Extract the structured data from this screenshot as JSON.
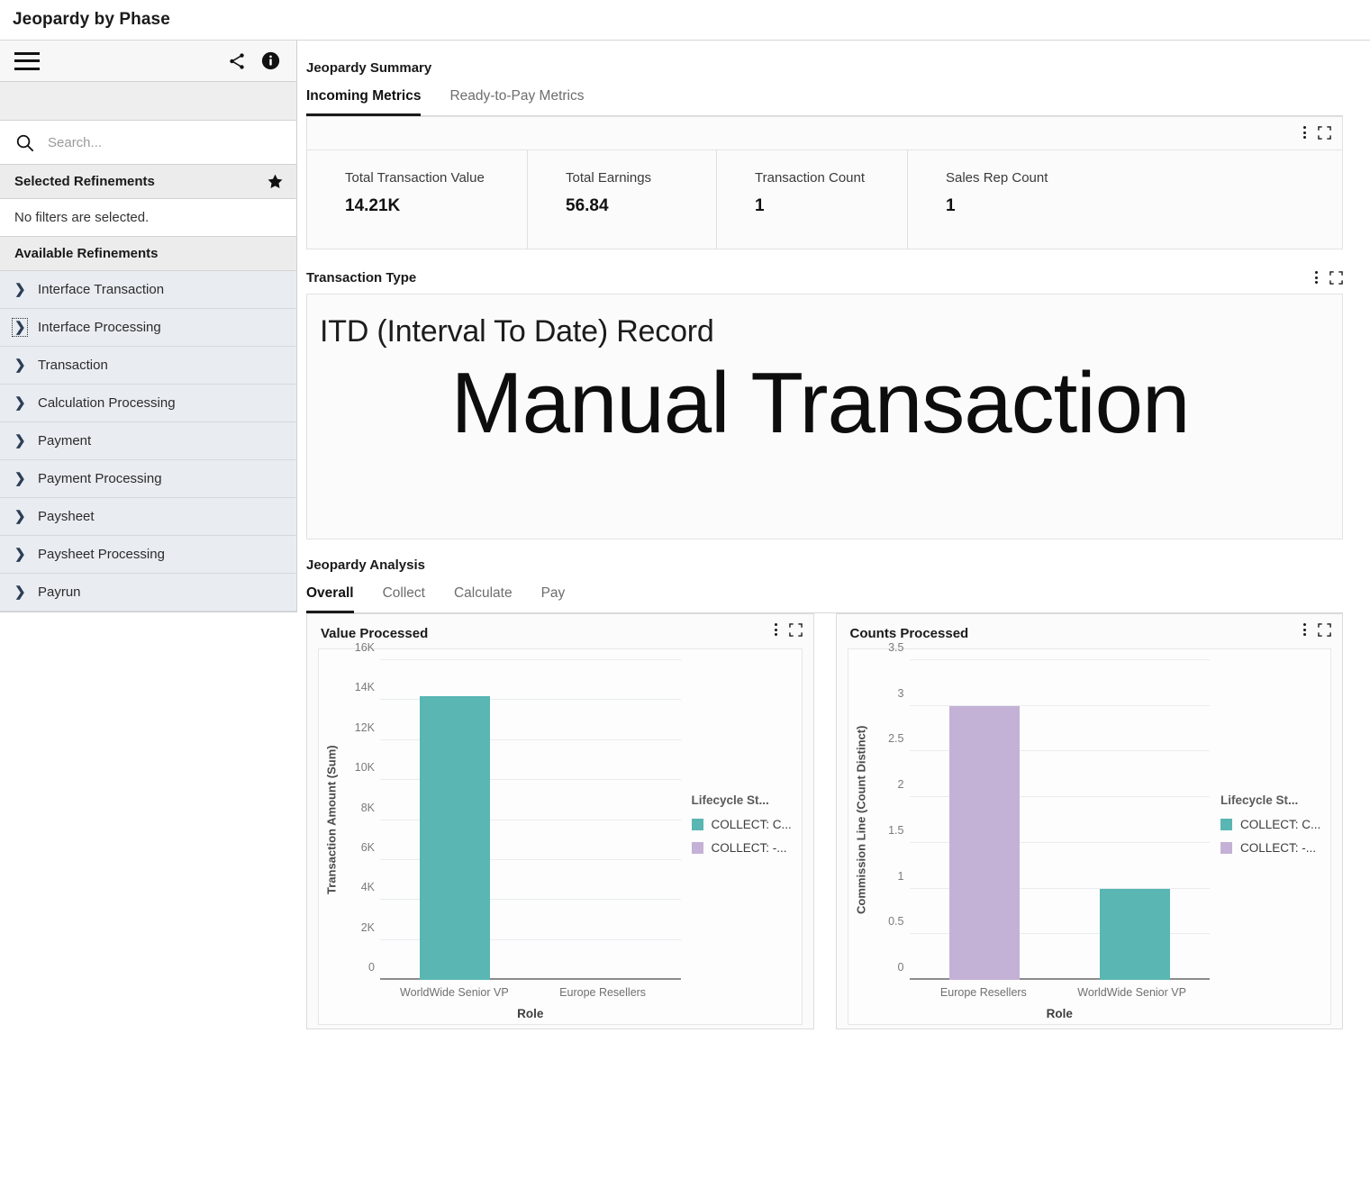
{
  "page": {
    "title": "Jeopardy by Phase"
  },
  "sidebar": {
    "toolbar": {
      "menu_icon": "hamburger-icon",
      "share_icon": "share-icon",
      "info_icon": "info-icon"
    },
    "search": {
      "placeholder": "Search...",
      "value": "",
      "icon": "search-icon"
    },
    "selected_refinements": {
      "label": "Selected Refinements",
      "star_icon": "star-icon",
      "empty_text": "No filters are selected."
    },
    "available_refinements": {
      "label": "Available Refinements",
      "items": [
        {
          "label": "Interface Transaction",
          "focused": false
        },
        {
          "label": "Interface Processing",
          "focused": true
        },
        {
          "label": "Transaction",
          "focused": false
        },
        {
          "label": "Calculation Processing",
          "focused": false
        },
        {
          "label": "Payment",
          "focused": false
        },
        {
          "label": "Payment Processing",
          "focused": false
        },
        {
          "label": "Paysheet",
          "focused": false
        },
        {
          "label": "Paysheet Processing",
          "focused": false
        },
        {
          "label": "Payrun",
          "focused": false
        }
      ]
    }
  },
  "summary": {
    "title": "Jeopardy Summary",
    "tabs": [
      {
        "label": "Incoming Metrics",
        "active": true
      },
      {
        "label": "Ready-to-Pay Metrics",
        "active": false
      }
    ],
    "metrics": [
      {
        "label": "Total Transaction Value",
        "value": "14.21K"
      },
      {
        "label": "Total Earnings",
        "value": "56.84"
      },
      {
        "label": "Transaction Count",
        "value": "1"
      },
      {
        "label": "Sales Rep Count",
        "value": "1"
      }
    ],
    "controls": {
      "menu_icon": "kebab-menu-icon",
      "expand_icon": "expand-icon"
    }
  },
  "transaction_type": {
    "title": "Transaction Type",
    "subtitle": "ITD (Interval To Date) Record",
    "value": "Manual Transaction",
    "controls": {
      "menu_icon": "kebab-menu-icon",
      "expand_icon": "expand-icon"
    }
  },
  "analysis": {
    "title": "Jeopardy Analysis",
    "tabs": [
      {
        "label": "Overall",
        "active": true
      },
      {
        "label": "Collect",
        "active": false
      },
      {
        "label": "Calculate",
        "active": false
      },
      {
        "label": "Pay",
        "active": false
      }
    ]
  },
  "colors": {
    "teal": "#59b6b3",
    "purple": "#c4b1d6",
    "accent_underline": "#1a1a1a",
    "sidebar_item_bg": "#e9edf2"
  },
  "chart_data": [
    {
      "type": "bar",
      "title": "Value Processed",
      "xlabel": "Role",
      "ylabel": "Transaction Amount (Sum)",
      "categories": [
        "WorldWide Senior VP",
        "Europe Resellers"
      ],
      "values": [
        14210,
        0
      ],
      "bar_colors": [
        "#59b6b3",
        "#c4b1d6"
      ],
      "ylim": [
        0,
        16000
      ],
      "yticks": [
        0,
        2000,
        4000,
        6000,
        8000,
        10000,
        12000,
        14000,
        16000
      ],
      "ytick_labels": [
        "0",
        "2K",
        "4K",
        "6K",
        "8K",
        "10K",
        "12K",
        "14K",
        "16K"
      ],
      "grid": true,
      "legend_position": "right",
      "legend_title": "Lifecycle St...",
      "legend": [
        {
          "label": "COLLECT: C...",
          "color": "#59b6b3"
        },
        {
          "label": "COLLECT: -...",
          "color": "#c4b1d6"
        }
      ]
    },
    {
      "type": "bar",
      "title": "Counts Processed",
      "xlabel": "Role",
      "ylabel": "Commission Line (Count Distinct)",
      "categories": [
        "Europe Resellers",
        "WorldWide Senior VP"
      ],
      "values": [
        3,
        1
      ],
      "bar_colors": [
        "#c4b1d6",
        "#59b6b3"
      ],
      "ylim": [
        0,
        3.5
      ],
      "yticks": [
        0,
        0.5,
        1,
        1.5,
        2,
        2.5,
        3,
        3.5
      ],
      "ytick_labels": [
        "0",
        "0.5",
        "1",
        "1.5",
        "2",
        "2.5",
        "3",
        "3.5"
      ],
      "grid": true,
      "legend_position": "right",
      "legend_title": "Lifecycle St...",
      "legend": [
        {
          "label": "COLLECT: C...",
          "color": "#59b6b3"
        },
        {
          "label": "COLLECT: -...",
          "color": "#c4b1d6"
        }
      ]
    }
  ]
}
